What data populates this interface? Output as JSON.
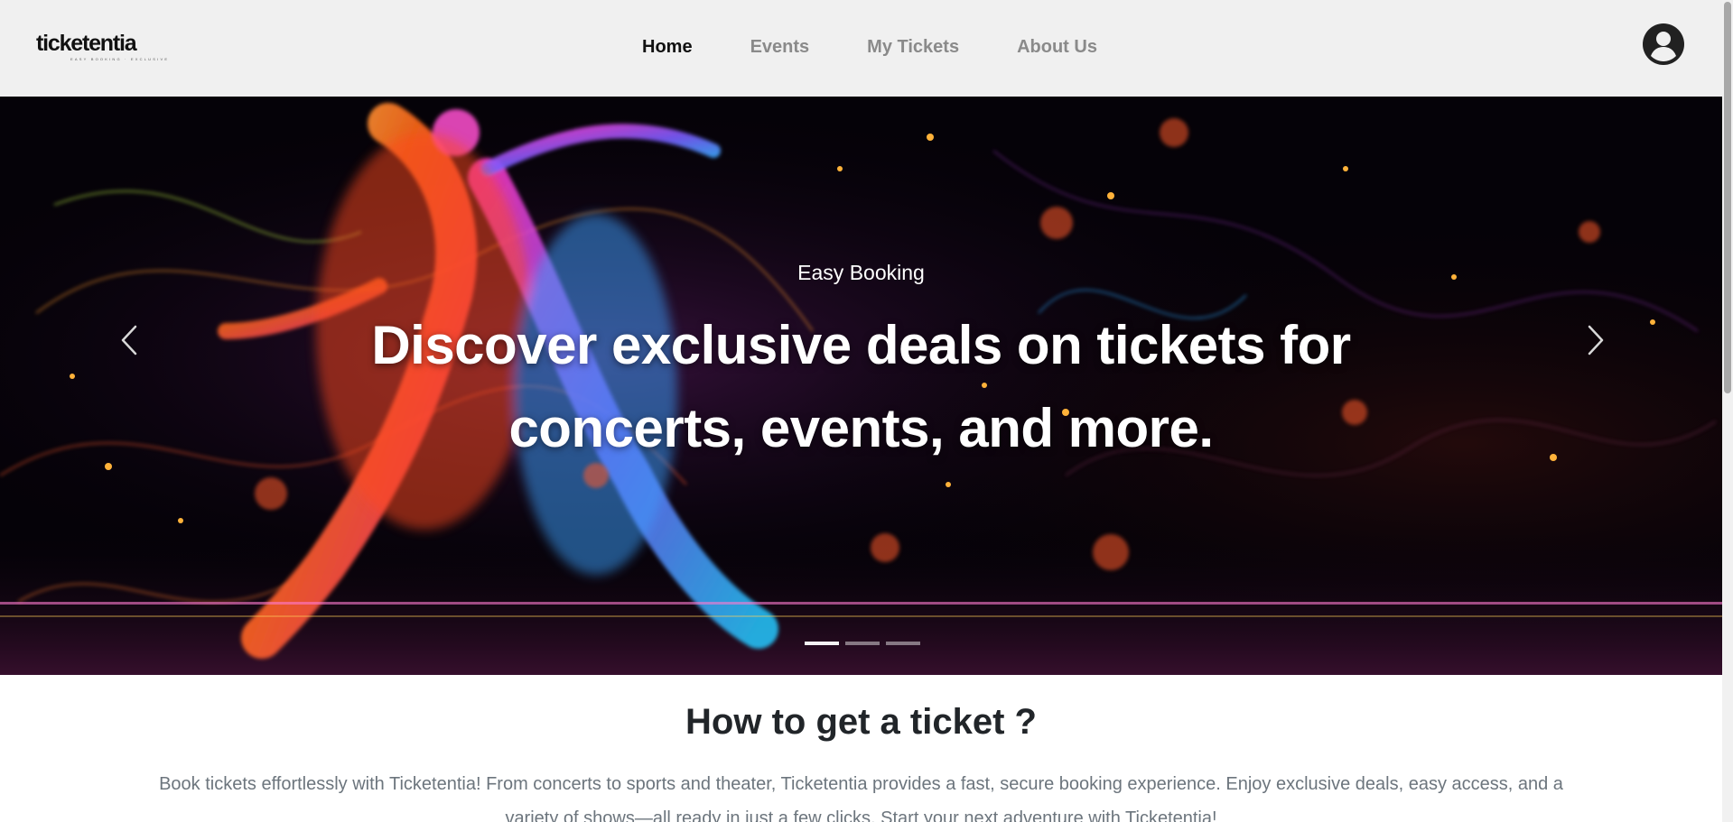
{
  "brand": {
    "name": "ticketentia",
    "tagline": "EASY BOOKING · EXCLUSIVE DEALS"
  },
  "nav": {
    "items": [
      {
        "label": "Home",
        "active": true
      },
      {
        "label": "Events",
        "active": false
      },
      {
        "label": "My Tickets",
        "active": false
      },
      {
        "label": "About Us",
        "active": false
      }
    ]
  },
  "hero": {
    "subtitle": "Easy Booking",
    "title": "Discover exclusive deals on tickets for concerts, events, and more.",
    "slides_total": 3,
    "active_slide": 1
  },
  "how_section": {
    "title": "How to get a ticket ?",
    "text": "Book tickets effortlessly with Ticketentia! From concerts to sports and theater, Ticketentia provides a fast, secure booking experience. Enjoy exclusive deals, easy access, and a variety of shows—all ready in just a few clicks. Start your next adventure with Ticketentia!"
  },
  "colors": {
    "header_bg": "#f0f0f0",
    "nav_active": "#111111",
    "nav_inactive": "#8a8a8a",
    "heading": "#212529",
    "body_text": "#6c757d"
  },
  "icons": {
    "avatar": "user-circle-icon",
    "prev": "chevron-left-icon",
    "next": "chevron-right-icon"
  }
}
